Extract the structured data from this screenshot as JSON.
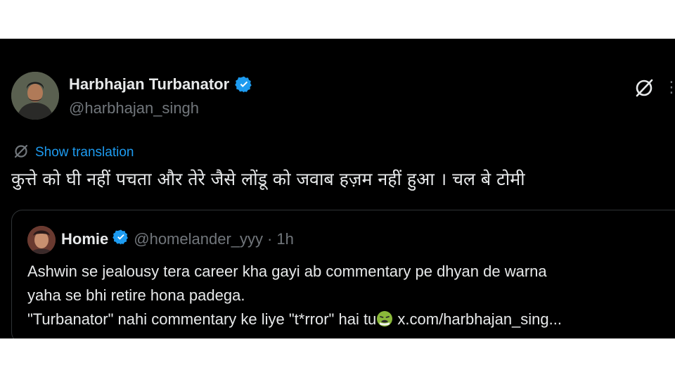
{
  "tweet": {
    "author": {
      "name": "Harbhajan Turbanator",
      "handle": "@harbhajan_singh",
      "verified": true
    },
    "show_translation": "Show translation",
    "text": "कुत्ते को घी नहीं पचता और तेरे जैसे लोंडू को जवाब हज़म नहीं हुआ । चल बे टोमी"
  },
  "quoted_tweet": {
    "author": {
      "name": "Homie",
      "handle": "@homelander_yyy",
      "separator": "·",
      "time": "1h",
      "verified": true
    },
    "lines": [
      "Ashwin se jealousy tera career kha gayi ab commentary pe dhyan de warna",
      "yaha se bhi retire hona padega."
    ],
    "line3_text": "\"Turbanator\" nahi commentary ke liye \"t*rror\" hai tu",
    "line3_link": " x.com/harbhajan_sing..."
  },
  "icons": {
    "verified": "verified-badge-icon",
    "grok": "grok-icon",
    "translate": "translate-icon",
    "emoji": "nauseated-face-emoji"
  },
  "colors": {
    "background": "#000000",
    "text": "#e7e9ea",
    "muted": "#71767b",
    "accent": "#1d9bf0"
  }
}
